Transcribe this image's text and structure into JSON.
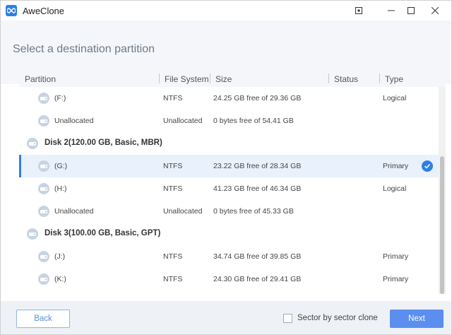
{
  "window": {
    "title": "AweClone",
    "controls": {
      "pin_icon": "pin-icon",
      "minimize": "—",
      "maximize": "☐",
      "close": "✕"
    }
  },
  "page": {
    "title": "Select a destination partition"
  },
  "table": {
    "columns": [
      "Partition",
      "File System",
      "Size",
      "Status",
      "Type"
    ],
    "rows": [
      {
        "kind": "partition",
        "name": "(F:)",
        "fs": "NTFS",
        "size": "24.25 GB free of 29.36 GB",
        "status": "",
        "type": "Logical",
        "selected": false
      },
      {
        "kind": "partition",
        "name": "Unallocated",
        "fs": "Unallocated",
        "size": "0 bytes free of 54.41 GB",
        "status": "",
        "type": "",
        "selected": false
      },
      {
        "kind": "disk",
        "name": "Disk 2(120.00 GB, Basic, MBR)"
      },
      {
        "kind": "partition",
        "name": "(G:)",
        "fs": "NTFS",
        "size": "23.22 GB free of 28.34 GB",
        "status": "",
        "type": "Primary",
        "selected": true
      },
      {
        "kind": "partition",
        "name": "(H:)",
        "fs": "NTFS",
        "size": "41.23 GB free of 46.34 GB",
        "status": "",
        "type": "Logical",
        "selected": false
      },
      {
        "kind": "partition",
        "name": "Unallocated",
        "fs": "Unallocated",
        "size": "0 bytes free of 45.33 GB",
        "status": "",
        "type": "",
        "selected": false
      },
      {
        "kind": "disk",
        "name": "Disk 3(100.00 GB, Basic, GPT)"
      },
      {
        "kind": "partition",
        "name": "(J:)",
        "fs": "NTFS",
        "size": "34.74 GB free of 39.85 GB",
        "status": "",
        "type": "Primary",
        "selected": false
      },
      {
        "kind": "partition",
        "name": "(K:)",
        "fs": "NTFS",
        "size": "24.30 GB free of 29.41 GB",
        "status": "",
        "type": "Primary",
        "selected": false
      }
    ]
  },
  "footer": {
    "back_label": "Back",
    "sector_label": "Sector by sector clone",
    "sector_checked": false,
    "next_label": "Next"
  },
  "colors": {
    "accent": "#2f7fe5",
    "next_button": "#5c8ef0",
    "selected_row": "#e9f1fc"
  }
}
